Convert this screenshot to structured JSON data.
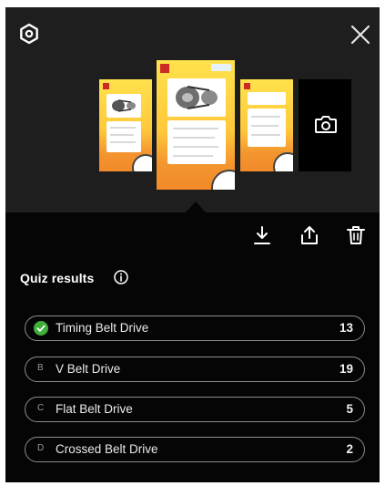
{
  "toolbar": {
    "settings_icon": "settings-icon",
    "close_icon": "close-icon"
  },
  "gallery": {
    "camera_icon": "camera-icon"
  },
  "actions": {
    "download_icon": "download-icon",
    "share_icon": "share-icon",
    "delete_icon": "trash-icon"
  },
  "quiz": {
    "title": "Quiz results",
    "info_icon": "info-icon",
    "options": [
      {
        "letter": "",
        "label": "Timing Belt Drive",
        "count": "13",
        "correct": true
      },
      {
        "letter": "B",
        "label": "V Belt Drive",
        "count": "19",
        "correct": false
      },
      {
        "letter": "C",
        "label": "Flat Belt Drive",
        "count": "5",
        "correct": false
      },
      {
        "letter": "D",
        "label": "Crossed Belt Drive",
        "count": "2",
        "correct": false
      }
    ]
  },
  "colors": {
    "background": "#050505",
    "preview_area": "#1e1e1e",
    "correct_green": "#3fae3a",
    "pill_border": "#8c8c8c"
  }
}
